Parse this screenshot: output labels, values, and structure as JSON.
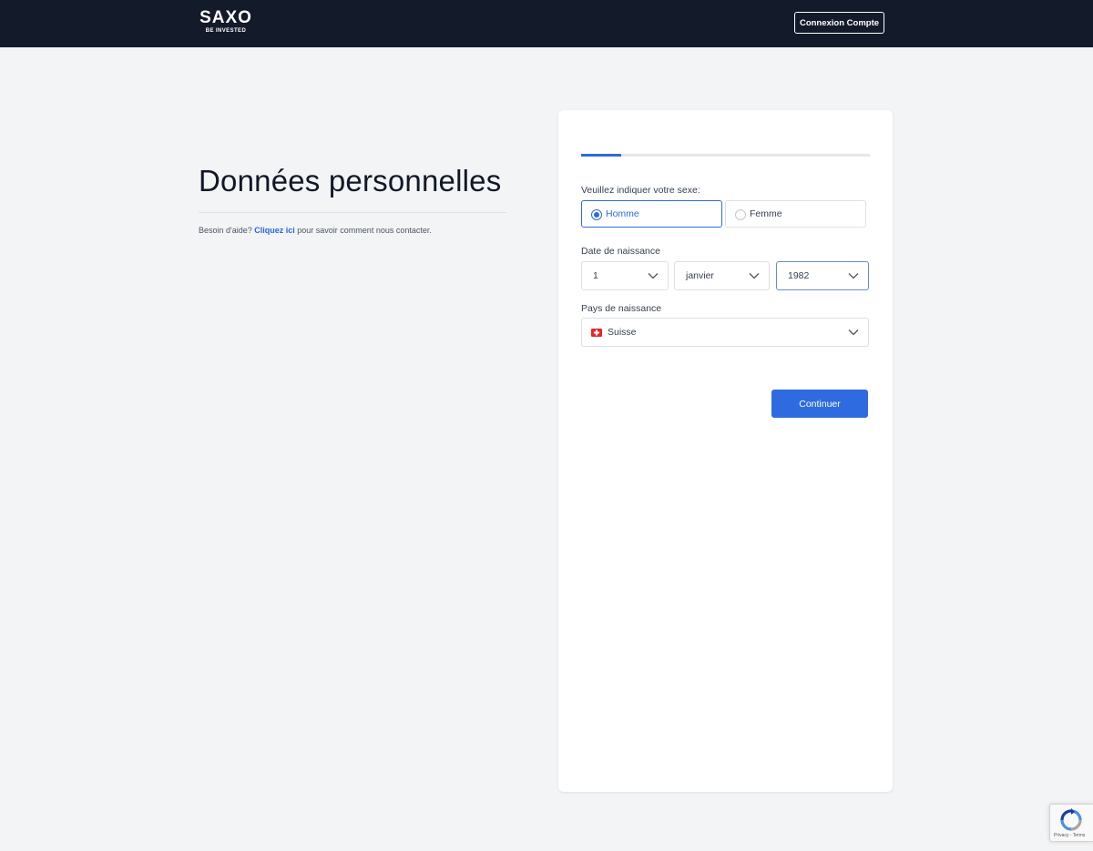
{
  "header": {
    "logo_text": "SAXO",
    "logo_tagline": "BE INVESTED",
    "login_button": "Connexion Compte"
  },
  "intro": {
    "title": "Données personnelles",
    "help_prefix": "Besoin d'aide? ",
    "help_link": "Cliquez ici",
    "help_suffix": " pour savoir comment nous contacter."
  },
  "form": {
    "progress": 0.14,
    "gender": {
      "label": "Veuillez indiquer votre sexe:",
      "options": [
        {
          "label": "Homme",
          "selected": true
        },
        {
          "label": "Femme",
          "selected": false
        }
      ]
    },
    "birth_date": {
      "label": "Date de naissance",
      "day": "1",
      "month": "janvier",
      "year": "1982"
    },
    "birth_country": {
      "label": "Pays de naissance",
      "value": "Suisse",
      "flag_icon": "swiss-flag-icon"
    },
    "continue_button": "Continuer"
  },
  "recaptcha": {
    "links": "Privacy - Terms"
  },
  "colors": {
    "header_bg": "#131a2a",
    "accent": "#2f6be0",
    "page_bg": "#f3f4f6"
  }
}
